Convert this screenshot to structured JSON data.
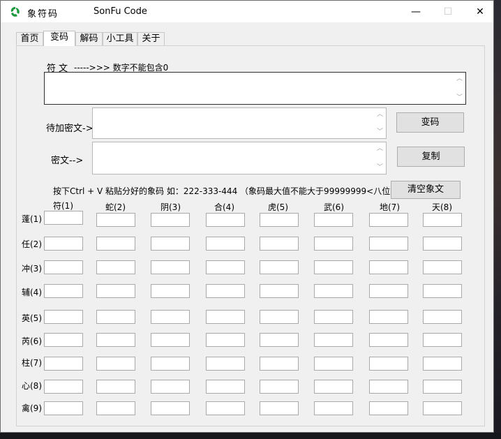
{
  "window": {
    "app_title": "象符码",
    "app_name": "SonFu Code",
    "minimize_glyph": "—",
    "maximize_glyph": "☐",
    "close_glyph": "✕"
  },
  "tabs": [
    {
      "label": "首页",
      "active": false
    },
    {
      "label": "变码",
      "active": true
    },
    {
      "label": "解码",
      "active": false
    },
    {
      "label": "小工具",
      "active": false
    },
    {
      "label": "关于",
      "active": false
    }
  ],
  "fuwen": {
    "label": "符文",
    "hint": "----->>> 数字不能包含0",
    "value": ""
  },
  "plaintext": {
    "label": "待加密文->",
    "value": ""
  },
  "ciphertext": {
    "label": "密文-->",
    "value": ""
  },
  "buttons": {
    "encode": "变码",
    "copy": "复制",
    "clear": "清空象文"
  },
  "paste_hint": "按下Ctrl + V 粘贴分好的象码 如：222-333-444 （象码最大值不能大于99999999<八位数>）",
  "grid": {
    "columns": [
      "符(1)",
      "蛇(2)",
      "阴(3)",
      "合(4)",
      "虎(5)",
      "武(6)",
      "地(7)",
      "天(8)"
    ],
    "rows": [
      "蓬(1)",
      "任(2)",
      "冲(3)",
      "辅(4)",
      "英(5)",
      "芮(6)",
      "柱(7)",
      "心(8)",
      "禽(9)"
    ]
  },
  "colors": {
    "icon_green": "#1a9a3a",
    "window_bg": "#f0f0f0",
    "button_bg": "#e1e1e1"
  }
}
